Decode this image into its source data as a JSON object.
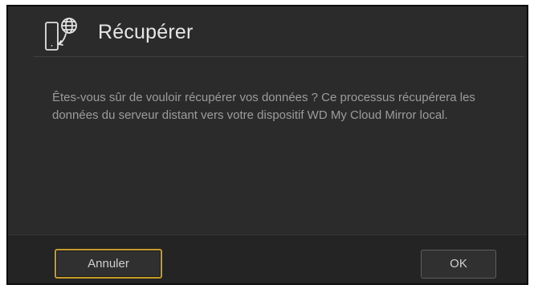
{
  "dialog": {
    "title": "Récupérer",
    "icon": "device-globe-restore-icon",
    "message": "Êtes-vous sûr de vouloir récupérer vos données ? Ce processus récupérera les données du serveur distant vers votre dispositif WD My Cloud Mirror local."
  },
  "footer": {
    "cancel_label": "Annuler",
    "ok_label": "OK"
  },
  "colors": {
    "dialog_background": "#2b2b2b",
    "footer_background": "#242424",
    "focus_border": "#c79b2a",
    "title_text": "#e6e6e6",
    "body_text": "#9c9c9c"
  }
}
